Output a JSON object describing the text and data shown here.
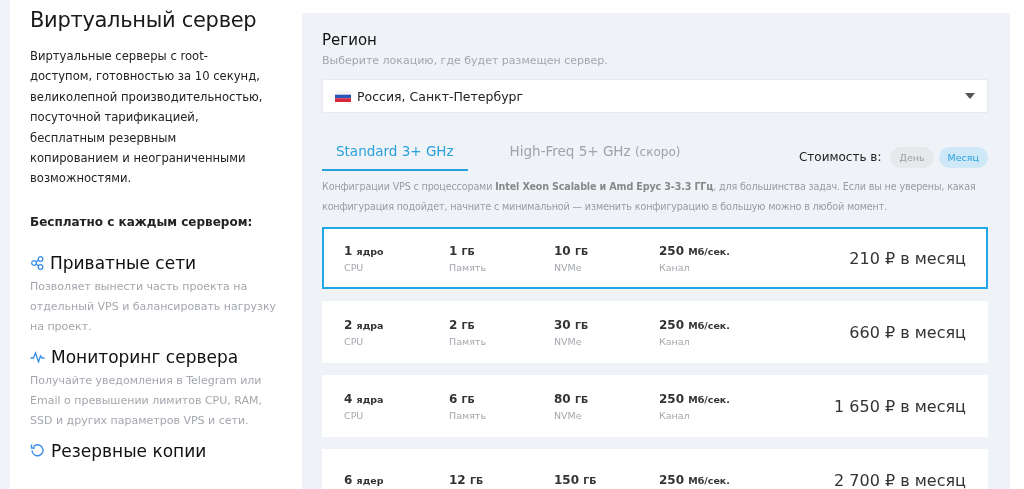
{
  "intro": {
    "title": "Виртуальный сервер",
    "description": "Виртуальные серверы с root-доступом, готовностью за 10 секунд, великолепной производительностью, посуточной тарификацией, бесплатным резервным копированием и неограниченными возможностями.",
    "free_heading": "Бесплатно с каждым сервером:"
  },
  "features": [
    {
      "kind": "network",
      "title": "Приватные сети",
      "text": "Позволяет вынести часть проекта на отдельный VPS и балансировать нагрузку на проект."
    },
    {
      "kind": "monitoring",
      "title": "Мониторинг сервера",
      "text": "Получайте уведомления в Telegram или Email о превышении лимитов CPU, RAM, SSD и других параметров VPS и сети."
    },
    {
      "kind": "backup",
      "title": "Резервные копии"
    }
  ],
  "region": {
    "title": "Регион",
    "hint": "Выберите локацию, где будет размещен сервер.",
    "value": "Россия, Санкт-Петербург"
  },
  "tabs": [
    {
      "label": "Standard 3+ GHz",
      "selected": true
    },
    {
      "label": "High-Freq 5+ GHz",
      "note": "(скоро)",
      "selected": false
    }
  ],
  "price_period": {
    "label": "Стоимость в:",
    "options": [
      {
        "label": "День",
        "selected": false
      },
      {
        "label": "Месяц",
        "selected": true
      }
    ]
  },
  "tab_description": "Конфиграции VPS с процессорами **Intel Xeon Scalable и Amd Epyc 3-3.3 ГГц**, для большинства задач. Если вы не уверены, какая конфигурация подойдет, начните с минимальной — изменить конфигурацию в большую можно в любой момент.",
  "plans": [
    {
      "selected": true,
      "specs": [
        {
          "value": "1",
          "unit": "ядро",
          "label": "CPU"
        },
        {
          "value": "1",
          "unit": "ГБ",
          "label": "Память"
        },
        {
          "value": "10",
          "unit": "ГБ",
          "label": "NVMe"
        },
        {
          "value": "250",
          "unit": "Мб/сек.",
          "label": "Канал"
        }
      ],
      "price": "210 ₽ в месяц"
    },
    {
      "selected": false,
      "specs": [
        {
          "value": "2",
          "unit": "ядра",
          "label": "CPU"
        },
        {
          "value": "2",
          "unit": "ГБ",
          "label": "Память"
        },
        {
          "value": "30",
          "unit": "ГБ",
          "label": "NVMe"
        },
        {
          "value": "250",
          "unit": "Мб/сек.",
          "label": "Канал"
        }
      ],
      "price": "660 ₽ в месяц"
    },
    {
      "selected": false,
      "specs": [
        {
          "value": "4",
          "unit": "ядра",
          "label": "CPU"
        },
        {
          "value": "6",
          "unit": "ГБ",
          "label": "Память"
        },
        {
          "value": "80",
          "unit": "ГБ",
          "label": "NVMe"
        },
        {
          "value": "250",
          "unit": "Мб/сек.",
          "label": "Канал"
        }
      ],
      "price": "1 650 ₽ в месяц"
    },
    {
      "selected": false,
      "specs": [
        {
          "value": "6",
          "unit": "ядер"
        },
        {
          "value": "12",
          "unit": "ГБ"
        },
        {
          "value": "150",
          "unit": "ГБ"
        },
        {
          "value": "250",
          "unit": "Мб/сек."
        }
      ],
      "price": "2 700 ₽ в месяц"
    }
  ]
}
